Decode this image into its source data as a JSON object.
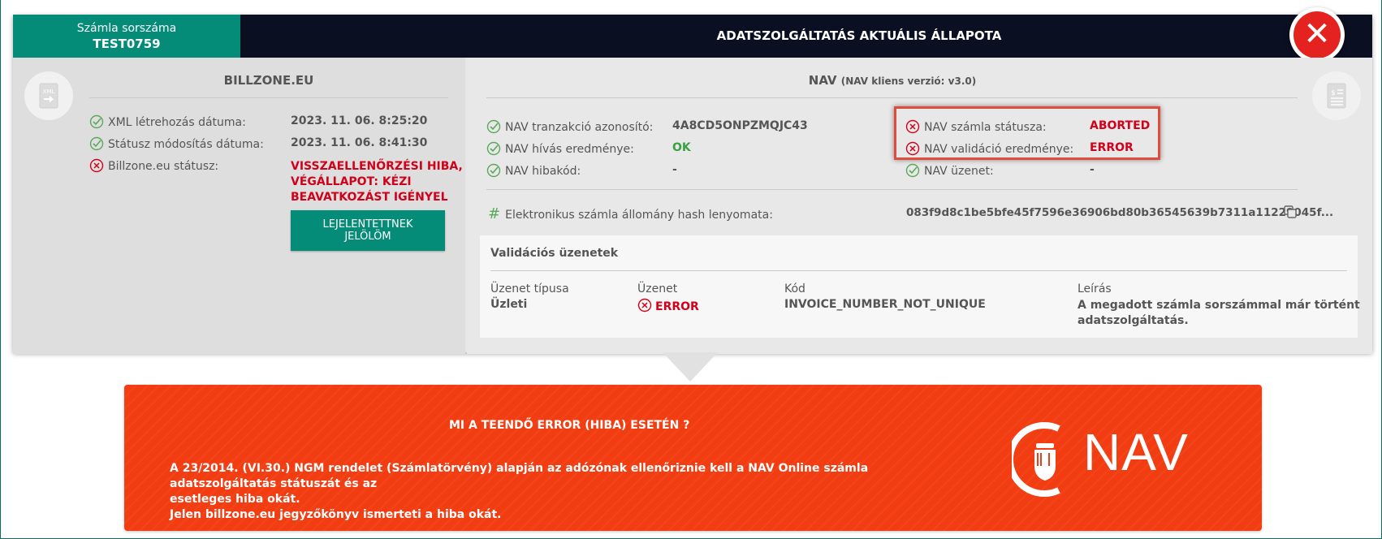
{
  "header": {
    "invoice_label": "Számla sorszáma",
    "invoice_number": "TEST0759",
    "title": "ADATSZOLGÁLTATÁS AKTUÁLIS ÁLLAPOTA",
    "close_icon": "close-icon"
  },
  "left": {
    "title": "BILLZONE.EU",
    "rows": [
      {
        "label": "XML létrehozás dátuma:",
        "value": "2023. 11. 06. 8:25:20",
        "status": "ok"
      },
      {
        "label": "Státusz módosítás dátuma:",
        "value": "2023. 11. 06. 8:41:30",
        "status": "ok"
      },
      {
        "label": "Billzone.eu státusz:",
        "value_lines": [
          "VISSZAELLENŐRZÉSI HIBA,",
          "VÉGÁLLAPOT: KÉZI",
          "BEAVATKOZÁST IGÉNYEL"
        ],
        "status": "error"
      }
    ],
    "button_lines": [
      "LEJELENTETTNEK",
      "JELÖLÖM"
    ]
  },
  "right": {
    "title": "NAV",
    "subtitle": "(NAV kliens verzió: v3.0)",
    "rows_left": [
      {
        "label": "NAV tranzakció azonosító:",
        "value": "4A8CD5ONPZMQJC43"
      },
      {
        "label": "NAV hívás eredménye:",
        "value": "OK"
      },
      {
        "label": "NAV hibakód:",
        "value": "-"
      }
    ],
    "rows_right": [
      {
        "label": "NAV számla státusza:",
        "value": "ABORTED"
      },
      {
        "label": "NAV validáció eredménye:",
        "value": "ERROR"
      },
      {
        "label": "NAV üzenet:",
        "value": "-"
      }
    ],
    "hash_label": "Elektronikus számla állomány hash lenyomata:",
    "hash_value": "083f9d8c1be5bfe45f7596e36906bd80b36545639b7311a11229045f..."
  },
  "validation": {
    "title": "Validációs üzenetek",
    "headers": [
      "Üzenet típusa",
      "Üzenet",
      "Kód",
      "Leírás"
    ],
    "row": {
      "type": "Üzleti",
      "message": "ERROR",
      "code": "INVOICE_NUMBER_NOT_UNIQUE",
      "desc_lines": [
        "A megadott számla sorszámmal már történt",
        "adatszolgáltatás."
      ]
    }
  },
  "banner": {
    "question": "MI A TEENDŐ ERROR (HIBA) ESETÉN ?",
    "text_lines": [
      "A 23/2014. (VI.30.) NGM rendelet (Számlatörvény) alapján az adózónak ellenőriznie kell a NAV Online számla adatszolgáltatás státuszát és az",
      "esetleges hiba okát.",
      "Jelen billzone.eu jegyzőkönyv ismerteti a hiba okát."
    ],
    "logo_text": "NAV"
  },
  "colors": {
    "green": "#048c78",
    "navy": "#0b0f22",
    "error_red": "#d0021b",
    "ok_green": "#3aa040",
    "banner_orange": "#f23d12"
  }
}
